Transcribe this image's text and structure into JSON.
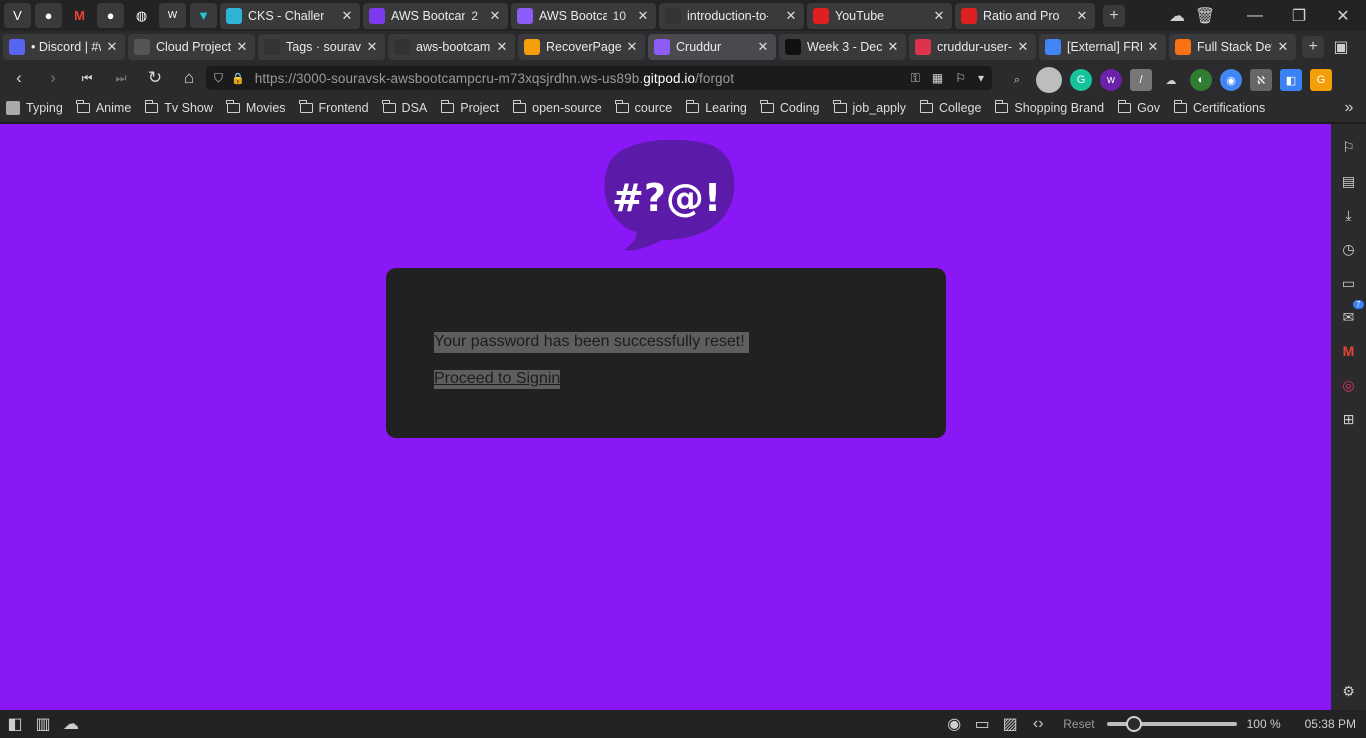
{
  "tabs_row1": {
    "pinned": [
      "vivaldi-icon",
      "github-icon",
      "gmail-icon",
      "github-icon",
      "globe-icon",
      "w-icon",
      "vs-icon"
    ],
    "tabs": [
      {
        "title": "CKS - Challenges",
        "count": "",
        "favicon": "cks-icon",
        "color": "#2fb4d8"
      },
      {
        "title": "AWS Bootcamp",
        "count": "2",
        "favicon": "u-icon",
        "color": "#7c3aed"
      },
      {
        "title": "AWS Bootcamp",
        "count": "10",
        "favicon": "cruddur-icon",
        "color": "#8b5cf6"
      },
      {
        "title": "introduction-to-",
        "count": "",
        "favicon": "github-icon",
        "color": "#333333"
      },
      {
        "title": "YouTube",
        "count": "",
        "favicon": "youtube-icon",
        "color": "#e02020"
      },
      {
        "title": "Ratio and Propor",
        "count": "",
        "favicon": "youtube-icon",
        "color": "#e02020"
      }
    ]
  },
  "tabs_row2": [
    {
      "title": "• Discord | #w",
      "favicon": "discord-icon",
      "color": "#5865f2"
    },
    {
      "title": "Cloud Project",
      "favicon": "doc-icon",
      "color": "#555555"
    },
    {
      "title": "Tags · souravs",
      "favicon": "github-icon",
      "color": "#333333"
    },
    {
      "title": "aws-bootcamp",
      "favicon": "github-icon",
      "color": "#333333"
    },
    {
      "title": "RecoverPage.j",
      "favicon": "gitpod-icon",
      "color": "#f59e0b"
    },
    {
      "title": "Cruddur",
      "favicon": "cruddur-icon",
      "color": "#8b5cf6"
    },
    {
      "title": "Week 3 - Dec",
      "favicon": "notion-icon",
      "color": "#111111"
    },
    {
      "title": "cruddur-user-",
      "favicon": "aws-icon",
      "color": "#dd344c"
    },
    {
      "title": "[External] FRE",
      "favicon": "docs-icon",
      "color": "#4285f4"
    },
    {
      "title": "Full Stack Dev",
      "favicon": "box-icon",
      "color": "#f97316"
    }
  ],
  "address": {
    "url_prefix": "https://3000-souravsk-awsbootcampcru-m73xqsjrdhn.ws-us89b.",
    "url_domain": "gitpod.io",
    "url_path": "/forgot"
  },
  "bookmarks": {
    "first": "Typing",
    "folders": [
      "Anime",
      "Tv Show",
      "Movies",
      "Frontend",
      "DSA",
      "Project",
      "open-source",
      "cource",
      "Learing",
      "Coding",
      "job_apply",
      "College",
      "Shopping Brand",
      "Gov",
      "Certifications"
    ]
  },
  "page": {
    "logo_text": "#?@!",
    "message": "Your password has been successfully reset!",
    "signin_link": "Proceed to Signin",
    "bg_color": "#8a17f5"
  },
  "side_panel": {
    "mail_badge": "7"
  },
  "status_bar": {
    "reset_label": "Reset",
    "zoom": "100 %",
    "zoom_fraction": 0.21,
    "time": "05:38 PM"
  }
}
